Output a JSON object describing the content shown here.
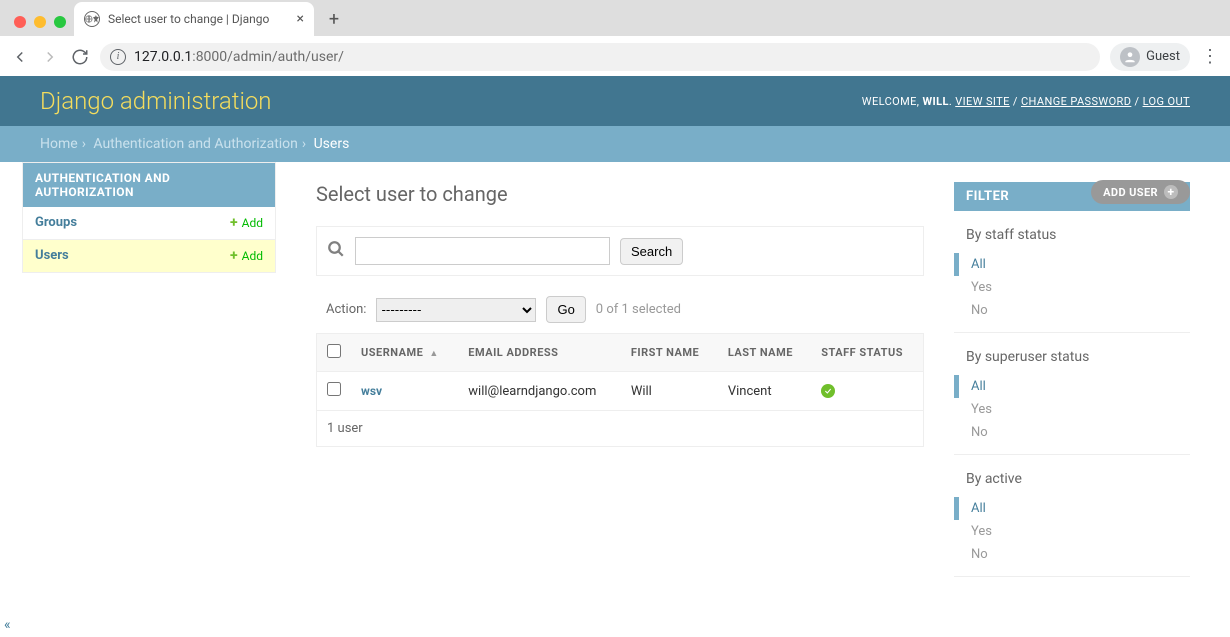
{
  "browser": {
    "tab_title": "Select user to change | Django",
    "url_host": "127.0.0.1",
    "url_port_path": ":8000/admin/auth/user/",
    "guest_label": "Guest"
  },
  "header": {
    "brand": "Django administration",
    "welcome": "WELCOME, ",
    "username": "WILL",
    "view_site": "VIEW SITE",
    "change_password": "CHANGE PASSWORD",
    "logout": "LOG OUT"
  },
  "breadcrumbs": {
    "home": "Home",
    "app": "Authentication and Authorization",
    "model": "Users"
  },
  "sidebar": {
    "section": "AUTHENTICATION AND AUTHORIZATION",
    "items": [
      {
        "name": "Groups",
        "add": "Add",
        "current": false
      },
      {
        "name": "Users",
        "add": "Add",
        "current": true
      }
    ]
  },
  "content": {
    "title": "Select user to change",
    "add_button": "ADD USER",
    "search_button": "Search",
    "action_label": "Action:",
    "action_default": "---------",
    "go_button": "Go",
    "selection_counter": "0 of 1 selected",
    "columns": {
      "username": "Username",
      "email": "Email address",
      "first_name": "First name",
      "last_name": "Last name",
      "staff": "Staff status"
    },
    "rows": [
      {
        "username": "wsv",
        "email": "will@learndjango.com",
        "first_name": "Will",
        "last_name": "Vincent",
        "staff": true
      }
    ],
    "paginator": "1 user"
  },
  "filters": {
    "title": "FILTER",
    "groups": [
      {
        "label": "By staff status",
        "options": [
          "All",
          "Yes",
          "No"
        ],
        "selected": "All"
      },
      {
        "label": "By superuser status",
        "options": [
          "All",
          "Yes",
          "No"
        ],
        "selected": "All"
      },
      {
        "label": "By active",
        "options": [
          "All",
          "Yes",
          "No"
        ],
        "selected": "All"
      }
    ]
  }
}
